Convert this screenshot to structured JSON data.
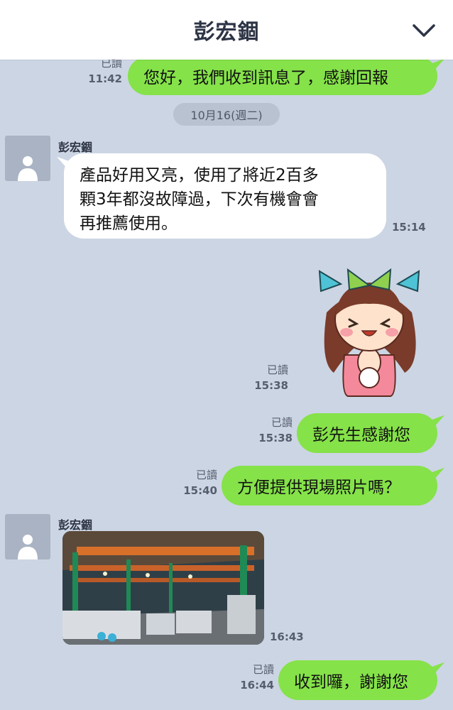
{
  "header": {
    "title": "彭宏錮"
  },
  "date_divider": "10月16(週二)",
  "contact": {
    "name": "彭宏錮"
  },
  "messages": {
    "m1": {
      "text": "您好，我們收到訊息了，感謝回報",
      "read": "已讀",
      "time": "11:42"
    },
    "m2": {
      "lines": [
        "產品好用又亮，使用了將近2百多",
        "顆3年都沒故障過，下次有機會會",
        "再推薦使用。"
      ],
      "time": "15:14"
    },
    "m3": {
      "read": "已讀",
      "time": "15:38"
    },
    "m4": {
      "text": "彭先生感謝您",
      "read": "已讀",
      "time": "15:38"
    },
    "m5": {
      "text": "方便提供現場照片嗎？",
      "read": "已讀",
      "time": "15:40"
    },
    "m6": {
      "time": "16:43"
    },
    "m7": {
      "text": "收到囉，謝謝您",
      "read": "已讀",
      "time": "16:44"
    }
  },
  "colors": {
    "chat_bg": "#ccd5e3",
    "outgoing_bubble": "#85e249",
    "incoming_bubble": "#ffffff",
    "header_bg": "#ffffff"
  }
}
